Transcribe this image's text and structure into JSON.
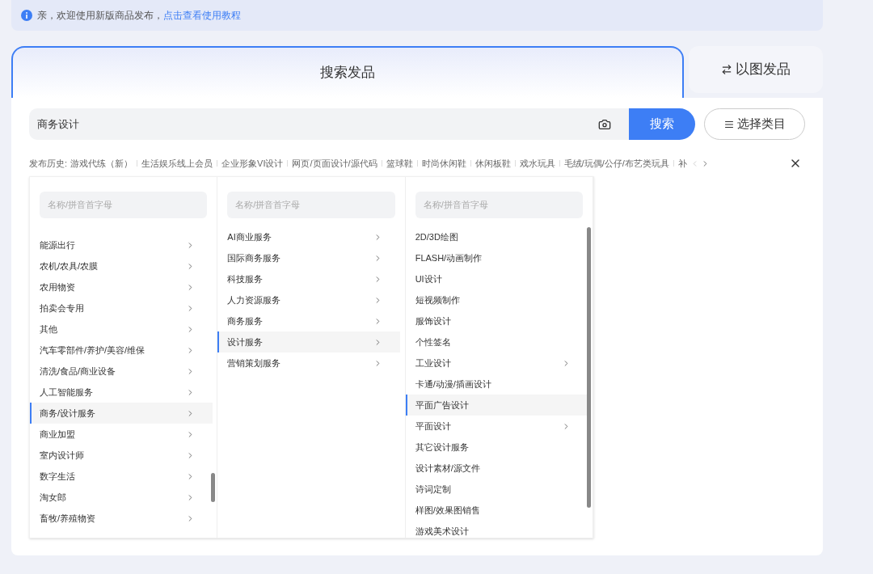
{
  "notice": {
    "text": "亲，欢迎使用新版商品发布，",
    "link": "点击查看使用教程"
  },
  "tabs": [
    {
      "label": "搜索发品",
      "selected": true
    },
    {
      "label": "以图发品",
      "selected": false
    }
  ],
  "search": {
    "value": "商务设计",
    "button": "搜索",
    "category_button": "选择类目"
  },
  "history": {
    "label": "发布历史:",
    "items": [
      "游戏代练（新）",
      "生活娱乐线上会员",
      "企业形象VI设计",
      "网页/页面设计/源代码",
      "篮球鞋",
      "时尚休闲鞋",
      "休闲板鞋",
      "戏水玩具",
      "毛绒/玩偶/公仔/布艺类玩具",
      "补"
    ]
  },
  "columns": [
    {
      "placeholder": "名称/拼音首字母",
      "items": [
        {
          "label": "能源出行",
          "has_children": true,
          "selected": false
        },
        {
          "label": "农机/农具/农膜",
          "has_children": true,
          "selected": false
        },
        {
          "label": "农用物资",
          "has_children": true,
          "selected": false
        },
        {
          "label": "拍卖会专用",
          "has_children": true,
          "selected": false
        },
        {
          "label": "其他",
          "has_children": true,
          "selected": false
        },
        {
          "label": "汽车零部件/养护/美容/维保",
          "has_children": true,
          "selected": false
        },
        {
          "label": "清洗/食品/商业设备",
          "has_children": true,
          "selected": false
        },
        {
          "label": "人工智能服务",
          "has_children": true,
          "selected": false
        },
        {
          "label": "商务/设计服务",
          "has_children": true,
          "selected": true
        },
        {
          "label": "商业加盟",
          "has_children": true,
          "selected": false
        },
        {
          "label": "室内设计师",
          "has_children": true,
          "selected": false
        },
        {
          "label": "数字生活",
          "has_children": true,
          "selected": false
        },
        {
          "label": "淘女郎",
          "has_children": true,
          "selected": false
        },
        {
          "label": "畜牧/养殖物资",
          "has_children": true,
          "selected": false
        }
      ]
    },
    {
      "placeholder": "名称/拼音首字母",
      "items": [
        {
          "label": "AI商业服务",
          "has_children": true,
          "selected": false
        },
        {
          "label": "国际商务服务",
          "has_children": true,
          "selected": false
        },
        {
          "label": "科技服务",
          "has_children": true,
          "selected": false
        },
        {
          "label": "人力资源服务",
          "has_children": true,
          "selected": false
        },
        {
          "label": "商务服务",
          "has_children": true,
          "selected": false
        },
        {
          "label": "设计服务",
          "has_children": true,
          "selected": true
        },
        {
          "label": "营销策划服务",
          "has_children": true,
          "selected": false
        }
      ]
    },
    {
      "placeholder": "名称/拼音首字母",
      "items": [
        {
          "label": "2D/3D绘图",
          "has_children": false,
          "selected": false
        },
        {
          "label": "FLASH/动画制作",
          "has_children": false,
          "selected": false
        },
        {
          "label": "UI设计",
          "has_children": false,
          "selected": false
        },
        {
          "label": "短视频制作",
          "has_children": false,
          "selected": false
        },
        {
          "label": "服饰设计",
          "has_children": false,
          "selected": false
        },
        {
          "label": "个性签名",
          "has_children": false,
          "selected": false
        },
        {
          "label": "工业设计",
          "has_children": true,
          "selected": false
        },
        {
          "label": "卡通/动漫/插画设计",
          "has_children": false,
          "selected": false
        },
        {
          "label": "平面广告设计",
          "has_children": false,
          "selected": true
        },
        {
          "label": "平面设计",
          "has_children": true,
          "selected": false
        },
        {
          "label": "其它设计服务",
          "has_children": false,
          "selected": false
        },
        {
          "label": "设计素材/源文件",
          "has_children": false,
          "selected": false
        },
        {
          "label": "诗词定制",
          "has_children": false,
          "selected": false
        },
        {
          "label": "样图/效果图销售",
          "has_children": false,
          "selected": false
        },
        {
          "label": "游戏美术设计",
          "has_children": false,
          "selected": false
        }
      ]
    }
  ]
}
